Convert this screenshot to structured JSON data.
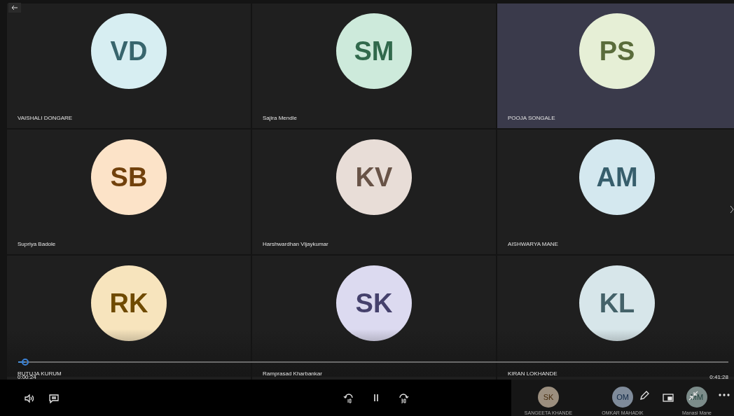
{
  "tiles": [
    {
      "initials": "VD",
      "name": "VAISHALI DONGARE",
      "color": "#d7eef2",
      "highlighted": false
    },
    {
      "initials": "SM",
      "name": "Sajira Mendle",
      "color": "#cdeadb",
      "highlighted": false
    },
    {
      "initials": "PS",
      "name": "POOJA SONGALE",
      "color": "#e6efd6",
      "highlighted": true
    },
    {
      "initials": "SB",
      "name": "Supriya Badole",
      "color": "#fce3c8",
      "highlighted": false
    },
    {
      "initials": "KV",
      "name": "Harshwardhan Vijaykumar",
      "color": "#e8ddd7",
      "highlighted": false
    },
    {
      "initials": "AM",
      "name": "AISHWARYA MANE",
      "color": "#d4e8ef",
      "highlighted": false
    },
    {
      "initials": "RK",
      "name": "RUTUJA KURUM",
      "color": "#f7e4bd",
      "highlighted": false
    },
    {
      "initials": "SK",
      "name": "Ramprasad Kharbankar",
      "color": "#dcdaf0",
      "highlighted": false
    },
    {
      "initials": "KL",
      "name": "KIRAN LOKHANDE",
      "color": "#d7e6ea",
      "highlighted": false
    }
  ],
  "playback": {
    "current_time": "0:00:24",
    "duration": "0:41:28",
    "level": 0.01,
    "playing": true
  },
  "strip": [
    {
      "initials": "SK",
      "name": "SANGEETA KHANDE",
      "color": "#9b8e7e"
    },
    {
      "initials": "OM",
      "name": "OMKAR MAHADIK",
      "color": "#7f8b9a"
    },
    {
      "initials": "MM",
      "name": "Manasi Mane",
      "color": "#7c8c8a"
    }
  ]
}
